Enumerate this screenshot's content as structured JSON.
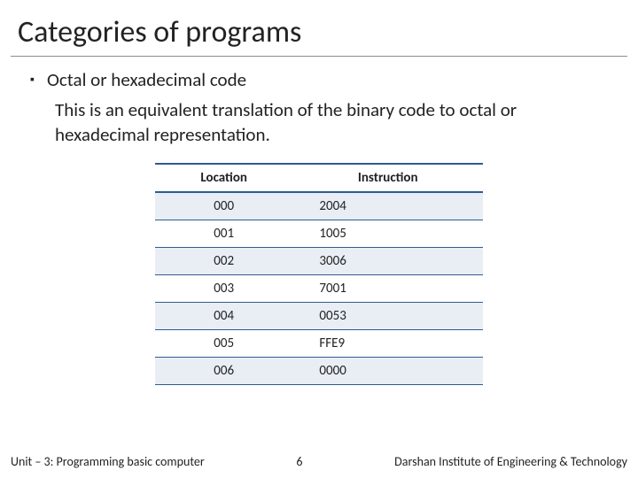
{
  "title": "Categories of programs",
  "bullet": {
    "mark": "▪",
    "heading": "Octal or hexadecimal code",
    "paragraph": "This is an equivalent translation of the binary code to octal or hexadecimal representation."
  },
  "table": {
    "headers": {
      "location": "Location",
      "instruction": "Instruction"
    },
    "rows": [
      {
        "location": "000",
        "instruction": "2004",
        "band": true
      },
      {
        "location": "001",
        "instruction": "1005",
        "band": false
      },
      {
        "location": "002",
        "instruction": "3006",
        "band": true
      },
      {
        "location": "003",
        "instruction": "7001",
        "band": false
      },
      {
        "location": "004",
        "instruction": "0053",
        "band": true
      },
      {
        "location": "005",
        "instruction": "FFE9",
        "band": false
      },
      {
        "location": "006",
        "instruction": "0000",
        "band": true
      }
    ]
  },
  "footer": {
    "left": "Unit – 3: Programming basic computer",
    "page": "6",
    "right": "Darshan Institute of Engineering & Technology"
  }
}
